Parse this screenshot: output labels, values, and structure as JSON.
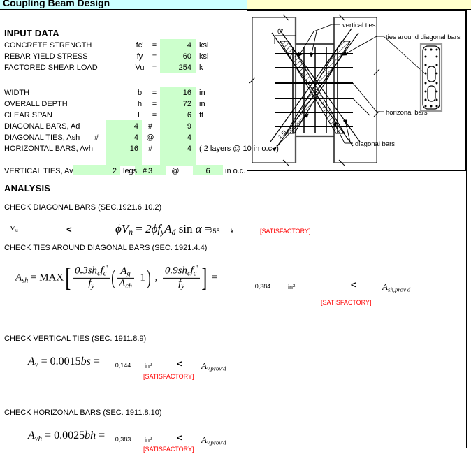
{
  "title": "Coupling Beam Design",
  "colors": {
    "title_left": "#ccffff",
    "title_right": "#ffffcc",
    "input_cell": "#ccffcc",
    "status_ok": "#ff0000"
  },
  "input": {
    "heading": "INPUT DATA",
    "rows": [
      {
        "label": "CONCRETE STRENGTH",
        "sym": "fc'",
        "eq": "=",
        "value": "4",
        "unit": "ksi",
        "note": ""
      },
      {
        "label": "REBAR YIELD STRESS",
        "sym": "fy",
        "eq": "=",
        "value": "60",
        "unit": "ksi",
        "note": ""
      },
      {
        "label": "FACTORED SHEAR LOAD",
        "sym": "Vu",
        "eq": "=",
        "value": "254",
        "unit": "k",
        "note": ""
      }
    ],
    "rows2": [
      {
        "label": "WIDTH",
        "sym": "b",
        "eq": "=",
        "value": "16",
        "unit": "in"
      },
      {
        "label": "OVERALL DEPTH",
        "sym": "h",
        "eq": "=",
        "value": "72",
        "unit": "in"
      },
      {
        "label": "CLEAR SPAN",
        "sym": "L",
        "eq": "=",
        "value": "6",
        "unit": "ft"
      }
    ],
    "bars": {
      "diag_label": "DIAGONAL BARS, Ad",
      "diag_count": "4",
      "diag_hash": "#",
      "diag_size": "9",
      "ties_label": "DIAGONAL TIES, Ash",
      "ties_pre_hash": "#",
      "ties_size": "4",
      "ties_at": "@",
      "ties_spacing": "4",
      "horiz_label": "HORIZONTAL BARS, Avh",
      "horiz_count": "16",
      "horiz_hash": "#",
      "horiz_size": "4",
      "horiz_note": "( 2 layers @ 10 in o.c. )",
      "vert_label": "VERTICAL TIES, Av",
      "vert_legs": "2",
      "vert_legs_word": "legs",
      "vert_hash": "#",
      "vert_size": "3",
      "vert_at": "@",
      "vert_spacing": "6",
      "vert_unit": "in o.c."
    }
  },
  "analysis": {
    "heading": "ANALYSIS",
    "checks": [
      {
        "title": "CHECK DIAGONAL BARS (SEC.1921.6.10.2)",
        "lhs": "Vu",
        "rel": "<",
        "value": "255",
        "unit": "k",
        "status": "[SATISFACTORY]"
      },
      {
        "title": "CHECK TIES AROUND DIAGONAL BARS (SEC. 1921.4.4)",
        "value": "0,384",
        "unit": "in",
        "unit_sup": "2",
        "rel": "<",
        "compare": "Ash,prov'd",
        "status": "[SATISFACTORY]"
      },
      {
        "title": "CHECK VERTICAL TIES (SEC. 1911.8.9)",
        "value": "0,144",
        "unit": "in",
        "unit_sup": "2",
        "rel": "<",
        "compare": "Av,prov'd",
        "status": "[SATISFACTORY]"
      },
      {
        "title": "CHECK HORIZONAL BARS (SEC. 1911.8.10)",
        "value": "0,383",
        "unit": "in",
        "unit_sup": "2",
        "rel": "<",
        "compare": "Av,prov'd",
        "status": "[SATISFACTORY]"
      }
    ]
  },
  "figure": {
    "label_vertical_ties": "vertical  ties",
    "label_ties_around": "ties  around  diagonal  bars",
    "label_horizontal_bars": "horizonal  bars",
    "label_diagonal_bars": "diagonal  bars",
    "dim_top": "6\"",
    "dim_diag": "1.5L"
  }
}
